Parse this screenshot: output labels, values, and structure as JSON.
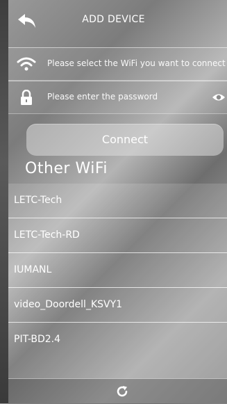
{
  "header": {
    "title": "ADD DEVICE",
    "back_icon": "back-arrow-icon"
  },
  "wifi_select": {
    "icon": "wifi-icon",
    "placeholder": "Please select the WiFi you want to connect to"
  },
  "password": {
    "icon": "lock-icon",
    "placeholder": "Please enter the password",
    "toggle_icon": "eye-icon"
  },
  "connect_label": "Connect",
  "other_wifi": {
    "title": "Other  WiFi",
    "networks": [
      "LETC-Tech",
      "LETC-Tech-RD",
      "IUMANL",
      "video_Doordell_KSVY1",
      "PIT-BD2.4"
    ]
  },
  "footer": {
    "refresh_icon": "refresh-icon"
  },
  "colors": {
    "text": "#ffffff",
    "background": "#9a9a9a"
  }
}
